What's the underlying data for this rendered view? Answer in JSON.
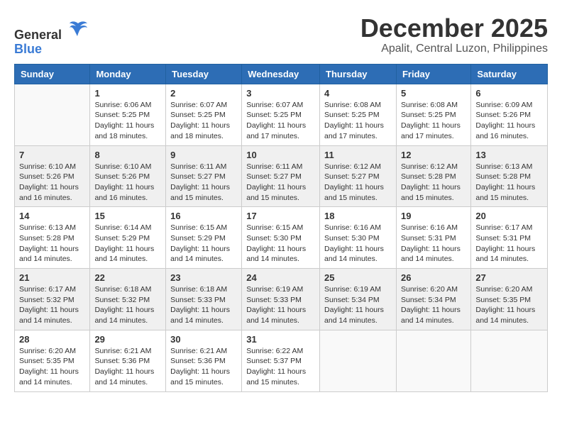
{
  "logo": {
    "general": "General",
    "blue": "Blue"
  },
  "title": {
    "month_year": "December 2025",
    "location": "Apalit, Central Luzon, Philippines"
  },
  "headers": [
    "Sunday",
    "Monday",
    "Tuesday",
    "Wednesday",
    "Thursday",
    "Friday",
    "Saturday"
  ],
  "weeks": [
    [
      {
        "day": "",
        "info": ""
      },
      {
        "day": "1",
        "info": "Sunrise: 6:06 AM\nSunset: 5:25 PM\nDaylight: 11 hours\nand 18 minutes."
      },
      {
        "day": "2",
        "info": "Sunrise: 6:07 AM\nSunset: 5:25 PM\nDaylight: 11 hours\nand 18 minutes."
      },
      {
        "day": "3",
        "info": "Sunrise: 6:07 AM\nSunset: 5:25 PM\nDaylight: 11 hours\nand 17 minutes."
      },
      {
        "day": "4",
        "info": "Sunrise: 6:08 AM\nSunset: 5:25 PM\nDaylight: 11 hours\nand 17 minutes."
      },
      {
        "day": "5",
        "info": "Sunrise: 6:08 AM\nSunset: 5:25 PM\nDaylight: 11 hours\nand 17 minutes."
      },
      {
        "day": "6",
        "info": "Sunrise: 6:09 AM\nSunset: 5:26 PM\nDaylight: 11 hours\nand 16 minutes."
      }
    ],
    [
      {
        "day": "7",
        "info": "Sunrise: 6:10 AM\nSunset: 5:26 PM\nDaylight: 11 hours\nand 16 minutes."
      },
      {
        "day": "8",
        "info": "Sunrise: 6:10 AM\nSunset: 5:26 PM\nDaylight: 11 hours\nand 16 minutes."
      },
      {
        "day": "9",
        "info": "Sunrise: 6:11 AM\nSunset: 5:27 PM\nDaylight: 11 hours\nand 15 minutes."
      },
      {
        "day": "10",
        "info": "Sunrise: 6:11 AM\nSunset: 5:27 PM\nDaylight: 11 hours\nand 15 minutes."
      },
      {
        "day": "11",
        "info": "Sunrise: 6:12 AM\nSunset: 5:27 PM\nDaylight: 11 hours\nand 15 minutes."
      },
      {
        "day": "12",
        "info": "Sunrise: 6:12 AM\nSunset: 5:28 PM\nDaylight: 11 hours\nand 15 minutes."
      },
      {
        "day": "13",
        "info": "Sunrise: 6:13 AM\nSunset: 5:28 PM\nDaylight: 11 hours\nand 15 minutes."
      }
    ],
    [
      {
        "day": "14",
        "info": "Sunrise: 6:13 AM\nSunset: 5:28 PM\nDaylight: 11 hours\nand 14 minutes."
      },
      {
        "day": "15",
        "info": "Sunrise: 6:14 AM\nSunset: 5:29 PM\nDaylight: 11 hours\nand 14 minutes."
      },
      {
        "day": "16",
        "info": "Sunrise: 6:15 AM\nSunset: 5:29 PM\nDaylight: 11 hours\nand 14 minutes."
      },
      {
        "day": "17",
        "info": "Sunrise: 6:15 AM\nSunset: 5:30 PM\nDaylight: 11 hours\nand 14 minutes."
      },
      {
        "day": "18",
        "info": "Sunrise: 6:16 AM\nSunset: 5:30 PM\nDaylight: 11 hours\nand 14 minutes."
      },
      {
        "day": "19",
        "info": "Sunrise: 6:16 AM\nSunset: 5:31 PM\nDaylight: 11 hours\nand 14 minutes."
      },
      {
        "day": "20",
        "info": "Sunrise: 6:17 AM\nSunset: 5:31 PM\nDaylight: 11 hours\nand 14 minutes."
      }
    ],
    [
      {
        "day": "21",
        "info": "Sunrise: 6:17 AM\nSunset: 5:32 PM\nDaylight: 11 hours\nand 14 minutes."
      },
      {
        "day": "22",
        "info": "Sunrise: 6:18 AM\nSunset: 5:32 PM\nDaylight: 11 hours\nand 14 minutes."
      },
      {
        "day": "23",
        "info": "Sunrise: 6:18 AM\nSunset: 5:33 PM\nDaylight: 11 hours\nand 14 minutes."
      },
      {
        "day": "24",
        "info": "Sunrise: 6:19 AM\nSunset: 5:33 PM\nDaylight: 11 hours\nand 14 minutes."
      },
      {
        "day": "25",
        "info": "Sunrise: 6:19 AM\nSunset: 5:34 PM\nDaylight: 11 hours\nand 14 minutes."
      },
      {
        "day": "26",
        "info": "Sunrise: 6:20 AM\nSunset: 5:34 PM\nDaylight: 11 hours\nand 14 minutes."
      },
      {
        "day": "27",
        "info": "Sunrise: 6:20 AM\nSunset: 5:35 PM\nDaylight: 11 hours\nand 14 minutes."
      }
    ],
    [
      {
        "day": "28",
        "info": "Sunrise: 6:20 AM\nSunset: 5:35 PM\nDaylight: 11 hours\nand 14 minutes."
      },
      {
        "day": "29",
        "info": "Sunrise: 6:21 AM\nSunset: 5:36 PM\nDaylight: 11 hours\nand 14 minutes."
      },
      {
        "day": "30",
        "info": "Sunrise: 6:21 AM\nSunset: 5:36 PM\nDaylight: 11 hours\nand 15 minutes."
      },
      {
        "day": "31",
        "info": "Sunrise: 6:22 AM\nSunset: 5:37 PM\nDaylight: 11 hours\nand 15 minutes."
      },
      {
        "day": "",
        "info": ""
      },
      {
        "day": "",
        "info": ""
      },
      {
        "day": "",
        "info": ""
      }
    ]
  ]
}
